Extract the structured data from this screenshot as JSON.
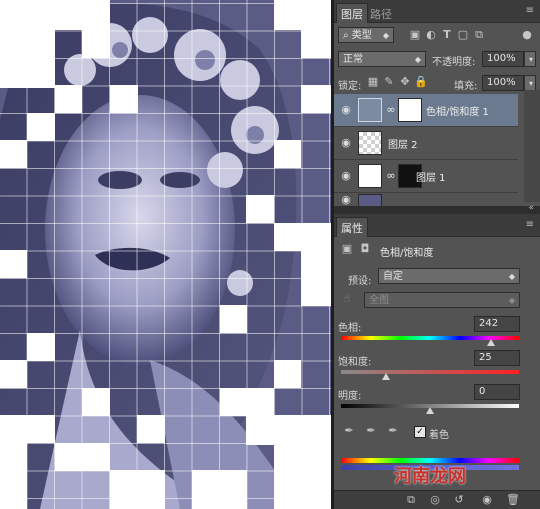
{
  "layers_panel": {
    "tabs": [
      "图层",
      "路径"
    ],
    "filter_kind": "类型",
    "blend_mode": "正常",
    "opacity_label": "不透明度:",
    "opacity_value": "100%",
    "lock_label": "锁定:",
    "fill_label": "填充:",
    "fill_value": "100%",
    "layers": [
      {
        "name": "色相/饱和度 1",
        "selected": true
      },
      {
        "name": "图层 2",
        "selected": false
      },
      {
        "name": "图层 1",
        "selected": false
      }
    ]
  },
  "properties_panel": {
    "tab": "属性",
    "title": "色相/饱和度",
    "preset_label": "预设:",
    "preset_value": "自定",
    "channel_value": "全图",
    "hue_label": "色相:",
    "hue_value": "242",
    "hue_level": 0.84,
    "saturation_label": "饱和度:",
    "saturation_value": "25",
    "saturation_level": 0.25,
    "lightness_label": "明度:",
    "lightness_value": "0",
    "lightness_level": 0.5,
    "colorize_label": "着色",
    "colorize_checked": true
  },
  "watermark": "河南龙网",
  "colors": {
    "canvas_tint": "#5a5c86",
    "panel_bg": "#535353",
    "selected_layer": "#6b7a8f"
  }
}
